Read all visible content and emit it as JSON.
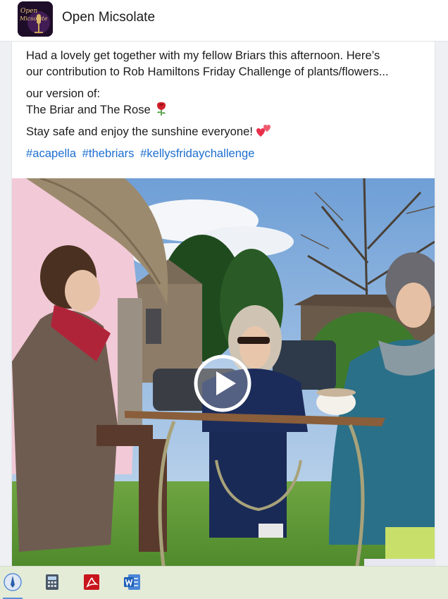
{
  "header": {
    "page_name": "Open Micsolate",
    "avatar_icon": "open-micsolate-logo"
  },
  "post": {
    "line1": "Had a lovely get together with my fellow Briars this afternoon. Here’s",
    "line2": "our contribution to Rob Hamiltons Friday Challenge of plants/flowers...",
    "version_intro": "our version of:",
    "song_title": "The Briar and The Rose",
    "song_emoji": "rose",
    "closing": "Stay safe and enjoy the sunshine everyone!",
    "closing_emoji": "two-hearts",
    "hashtags": [
      "#acapella",
      "#thebriars",
      "#kellysfridaychallenge"
    ],
    "hashtag_color": "#1e6fd0"
  },
  "video": {
    "play_icon": "play-icon"
  },
  "taskbar": {
    "icons": [
      "pen-icon",
      "calculator-icon",
      "pdf-icon",
      "word-icon"
    ]
  }
}
